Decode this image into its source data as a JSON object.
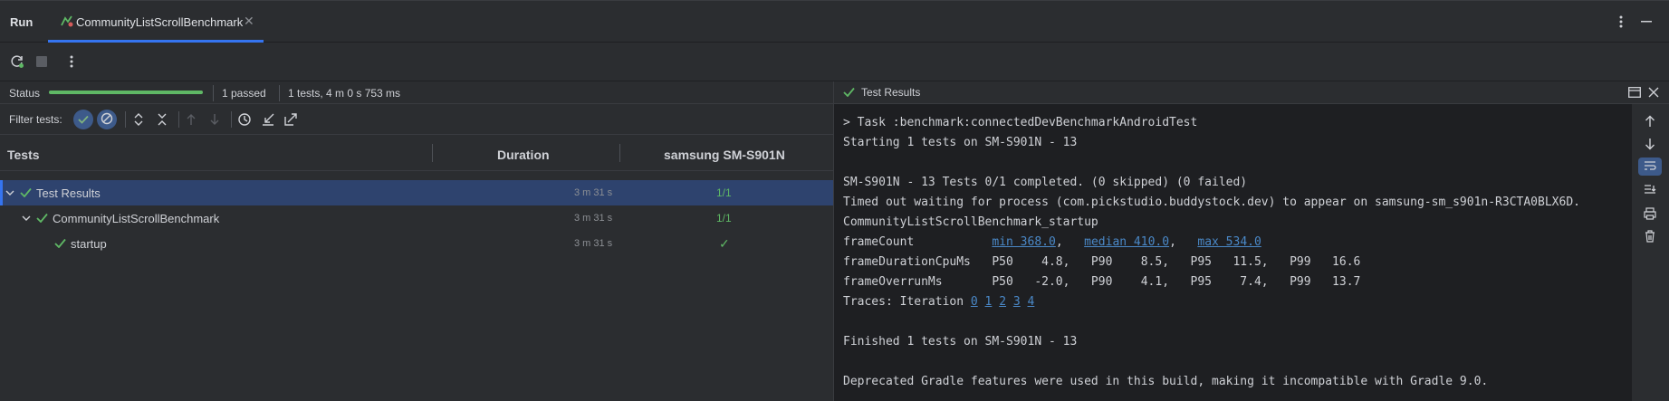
{
  "topbar": {
    "run_label": "Run",
    "tab_label": "CommunityListScrollBenchmark"
  },
  "status": {
    "label": "Status",
    "progress": 1.0,
    "passed": "1 passed",
    "summary": "1 tests, 4 m 0 s 753 ms"
  },
  "filter": {
    "label": "Filter tests:"
  },
  "columns": {
    "tests": "Tests",
    "duration": "Duration",
    "device": "samsung SM-S901N"
  },
  "tree": [
    {
      "name": "Test Results",
      "duration": "3 m 31 s",
      "result": "1/1"
    },
    {
      "name": "CommunityListScrollBenchmark",
      "duration": "3 m 31 s",
      "result": "1/1"
    },
    {
      "name": "startup",
      "duration": "3 m 31 s",
      "result": "✓"
    }
  ],
  "results_panel": {
    "title": "Test Results"
  },
  "console": {
    "l1": "> Task :benchmark:connectedDevBenchmarkAndroidTest",
    "l2": "Starting 1 tests on SM-S901N - 13",
    "l3": "SM-S901N - 13 Tests 0/1 completed. (0 skipped) (0 failed)",
    "l4": "Timed out waiting for process (com.pickstudio.buddystock.dev) to appear on samsung-sm_s901n-R3CTA0BLX6D.",
    "l5": "CommunityListScrollBenchmark_startup",
    "fc_label": "frameCount",
    "fc_min": "min 368.0",
    "fc_median": "median 410.0",
    "fc_max": "max 534.0",
    "l7": "frameDurationCpuMs   P50    4.8,   P90    8.5,   P95   11.5,   P99   16.6",
    "l8": "frameOverrunMs       P50   -2.0,   P90    4.1,   P95    7.4,   P99   13.7",
    "traces_label": "Traces: Iteration",
    "traces": [
      "0",
      "1",
      "2",
      "3",
      "4"
    ],
    "l10": "Finished 1 tests on SM-S901N - 13",
    "l11": "Deprecated Gradle features were used in this build, making it incompatible with Gradle 9.0."
  },
  "colors": {
    "accent": "#3574f0",
    "pass": "#5fb865",
    "link": "#4a88c7",
    "selection": "#2e436e"
  }
}
